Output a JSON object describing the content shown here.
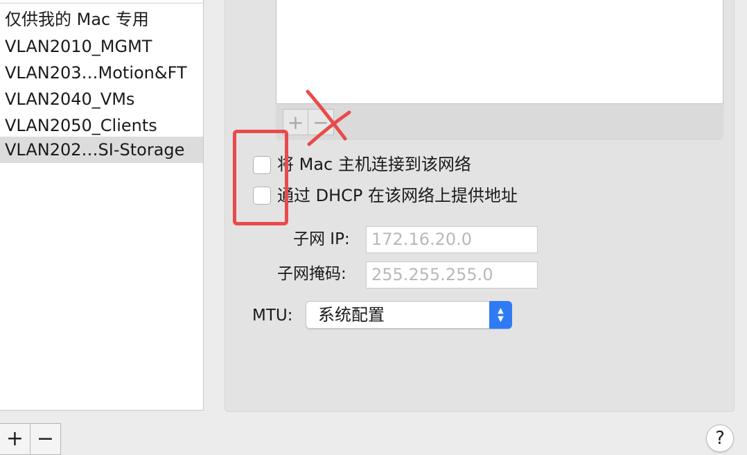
{
  "networks": [
    {
      "label": "仅供我的 Mac 专用",
      "selected": false
    },
    {
      "label": "VLAN2010_MGMT",
      "selected": false
    },
    {
      "label": "VLAN203…Motion&FT",
      "selected": false
    },
    {
      "label": "VLAN2040_VMs",
      "selected": false
    },
    {
      "label": "VLAN2050_Clients",
      "selected": false
    },
    {
      "label": "VLAN202…SI-Storage",
      "selected": true
    }
  ],
  "list_tools": {
    "add": "+",
    "remove": "−"
  },
  "ports_tools": {
    "add": "+",
    "remove": "−"
  },
  "options": {
    "connect_host": {
      "label": "将 Mac 主机连接到该网络",
      "checked": false
    },
    "dhcp": {
      "label": "通过 DHCP 在该网络上提供地址",
      "checked": false
    }
  },
  "subnet": {
    "ip_label": "子网 IP:",
    "ip_value": "172.16.20.0",
    "mask_label": "子网掩码:",
    "mask_value": "255.255.255.0"
  },
  "mtu": {
    "label": "MTU:",
    "value": "系统配置"
  },
  "help": "?",
  "colors": {
    "annotation_red": "#ea4a4a",
    "accent_blue": "#2f7bf5"
  }
}
